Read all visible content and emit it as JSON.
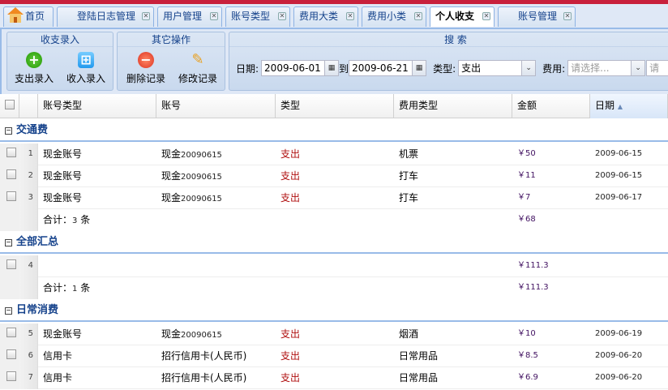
{
  "tabs": [
    {
      "label": "首页",
      "closable": false
    },
    {
      "label": "登陆日志管理",
      "closable": true
    },
    {
      "label": "用户管理",
      "closable": true
    },
    {
      "label": "账号类型",
      "closable": true
    },
    {
      "label": "费用大类",
      "closable": true
    },
    {
      "label": "费用小类",
      "closable": true
    },
    {
      "label": "个人收支",
      "closable": true,
      "active": true
    },
    {
      "label": "账号管理",
      "closable": true
    }
  ],
  "toolbar": {
    "entry_group": "收支录入",
    "expense_entry": "支出录入",
    "income_entry": "收入录入",
    "other_group": "其它操作",
    "delete": "删除记录",
    "edit": "修改记录",
    "search_group": "搜 索",
    "date_label": "日期:",
    "date_from": "2009-06-01",
    "to_label": "到",
    "date_to": "2009-06-21",
    "type_label": "类型:",
    "type_value": "支出",
    "fee_label": "费用:",
    "fee_placeholder": "请选择...",
    "extra_placeholder": "请"
  },
  "columns": [
    "账号类型",
    "账号",
    "类型",
    "费用类型",
    "金额",
    "日期"
  ],
  "sort_indicator": "▲",
  "groups": [
    {
      "name": "交通费",
      "rows": [
        {
          "n": "1",
          "acct_type": "现金账号",
          "acct": "现金",
          "acct_no": "20090615",
          "type": "支出",
          "fee": "机票",
          "amount": "￥50",
          "date": "2009-06-15"
        },
        {
          "n": "2",
          "acct_type": "现金账号",
          "acct": "现金",
          "acct_no": "20090615",
          "type": "支出",
          "fee": "打车",
          "amount": "￥11",
          "date": "2009-06-15"
        },
        {
          "n": "3",
          "acct_type": "现金账号",
          "acct": "现金",
          "acct_no": "20090615",
          "type": "支出",
          "fee": "打车",
          "amount": "￥7",
          "date": "2009-06-17"
        }
      ],
      "summary": {
        "label": "合计：",
        "count": "3",
        "unit": "条",
        "amount": "￥68"
      }
    },
    {
      "name": "全部汇总",
      "rows": [
        {
          "n": "4",
          "acct_type": "",
          "acct": "",
          "acct_no": "",
          "type": "",
          "fee": "",
          "amount": "￥111.3",
          "date": ""
        }
      ],
      "summary": {
        "label": "合计：",
        "count": "1",
        "unit": "条",
        "amount": "￥111.3"
      }
    },
    {
      "name": "日常消费",
      "rows": [
        {
          "n": "5",
          "acct_type": "现金账号",
          "acct": "现金",
          "acct_no": "20090615",
          "type": "支出",
          "fee": "烟酒",
          "amount": "￥10",
          "date": "2009-06-19"
        },
        {
          "n": "6",
          "acct_type": "信用卡",
          "acct": "招行信用卡(人民币)",
          "acct_no": "",
          "type": "支出",
          "fee": "日常用品",
          "amount": "￥8.5",
          "date": "2009-06-20"
        },
        {
          "n": "7",
          "acct_type": "信用卡",
          "acct": "招行信用卡(人民币)",
          "acct_no": "",
          "type": "支出",
          "fee": "日常用品",
          "amount": "￥6.9",
          "date": "2009-06-20"
        }
      ]
    }
  ]
}
